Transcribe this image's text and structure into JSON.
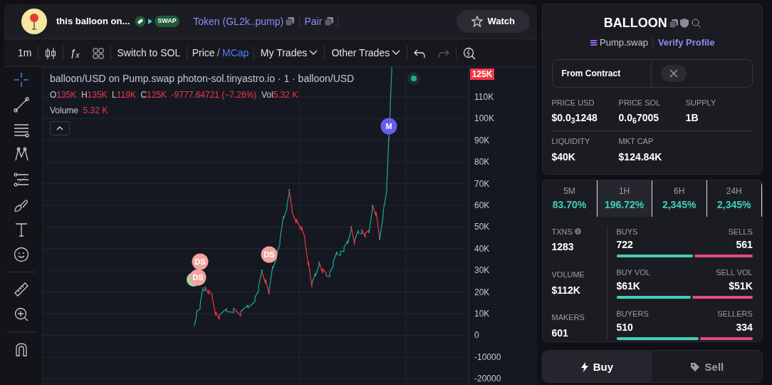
{
  "header": {
    "token_name": "this balloon on...",
    "badge_text": "SWAP",
    "token_link": "Token (GL2k..pump)",
    "pair_link": "Pair",
    "watch_button": "Watch"
  },
  "toolbar": {
    "interval": "1m",
    "indicator_glyph": "ƒ$_{x}$",
    "switch_button": "Switch to SOL",
    "price_mode": [
      {
        "label": "Price",
        "selected": false
      },
      {
        "label": "MCap",
        "selected": true
      }
    ],
    "mode_separator": "/",
    "dropdowns": [
      "My Trades",
      "Other Trades"
    ],
    "redo_disabled": true
  },
  "chart": {
    "title": "balloon/USD on Pump.swap photon-sol.tinyastro.io · 1 · balloon/USD",
    "ohlc": [
      {
        "label": "O",
        "value": "135K"
      },
      {
        "label": "H",
        "value": "135K"
      },
      {
        "label": "L",
        "value": "119K"
      },
      {
        "label": "C",
        "value": "125K"
      }
    ],
    "change": "-9777.64721 (−7.26%)",
    "vol_label": "Vol",
    "vol_value": "5.32 K",
    "volume_label": "Volume",
    "volume_value": "5.32 K",
    "current_price": "125K",
    "y_labels": [
      "110K",
      "100K",
      "90K",
      "80K",
      "70K",
      "60K",
      "50K",
      "40K",
      "30K",
      "20K",
      "10K",
      "0",
      "-10000",
      "-20000"
    ],
    "markers": [
      {
        "text": "DS",
        "kind": "dev"
      },
      {
        "text": "DS",
        "kind": "dev"
      },
      {
        "text": "DS",
        "kind": "dev"
      },
      {
        "text": "M",
        "kind": "migration"
      }
    ]
  },
  "token": {
    "symbol": "BALLOON",
    "dex": "Pump.swap",
    "verify_link": "Verify Profile",
    "contract_label": "From Contract",
    "stats": [
      {
        "label": "PRICE USD",
        "value": "$0.0$_{3}$1248"
      },
      {
        "label": "PRICE SOL",
        "value": "0.0$_{6}$7005"
      },
      {
        "label": "SUPPLY",
        "value": "1B"
      },
      {
        "label": "LIQUIDITY",
        "value": "$40K"
      },
      {
        "label": "MKT CAP",
        "value": "$124.84K"
      }
    ]
  },
  "periods": [
    {
      "label": "5M",
      "change": "83.70%",
      "selected": false
    },
    {
      "label": "1H",
      "change": "196.72%",
      "selected": true
    },
    {
      "label": "6H",
      "change": "2,345%",
      "selected": false
    },
    {
      "label": "24H",
      "change": "2,345%",
      "selected": false
    }
  ],
  "activity": {
    "totals": [
      {
        "label": "TXNS",
        "value": "1283",
        "info": true
      },
      {
        "label": "VOLUME",
        "value": "$112K",
        "info": false
      },
      {
        "label": "MAKERS",
        "value": "601",
        "info": false
      }
    ],
    "splits": [
      {
        "left_label": "BUYS",
        "left_value": "722",
        "right_label": "SELLS",
        "right_value": "561",
        "level": 0.563
      },
      {
        "left_label": "BUY VOL",
        "left_value": "$61K",
        "right_label": "SELL VOL",
        "right_value": "$51K",
        "level": 0.545
      },
      {
        "left_label": "BUYERS",
        "left_value": "510",
        "right_label": "SELLERS",
        "right_value": "334",
        "level": 0.604
      }
    ]
  },
  "trade_tabs": [
    {
      "label": "Buy",
      "kind": "buy",
      "selected": true
    },
    {
      "label": "Sell",
      "kind": "sell",
      "selected": false
    }
  ]
}
